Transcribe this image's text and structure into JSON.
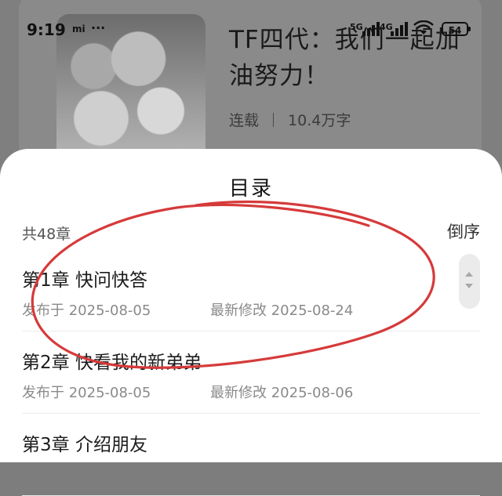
{
  "status_bar": {
    "time": "9:19",
    "brand": "mi",
    "dots": "···",
    "net_1": "5G",
    "net_2": "4G",
    "battery": "54"
  },
  "book": {
    "title": "TF四代：我们一起加油努力！",
    "status": "连载",
    "word_count": "10.4万字"
  },
  "catalog": {
    "title": "目录",
    "chapter_count": "共48章",
    "sort_label": "倒序",
    "chapters": [
      {
        "title": "第1章 快问快答",
        "published": "发布于 2025-08-05",
        "modified": "最新修改 2025-08-24"
      },
      {
        "title": "第2章 快看我的新弟弟",
        "published": "发布于 2025-08-05",
        "modified": "最新修改 2025-08-06"
      },
      {
        "title": "第3章 介绍朋友",
        "published": "",
        "modified": ""
      }
    ]
  },
  "colors": {
    "annotation": "#d63a3a",
    "sheet": "#ffffff",
    "overlay": "#7f7f7f"
  }
}
